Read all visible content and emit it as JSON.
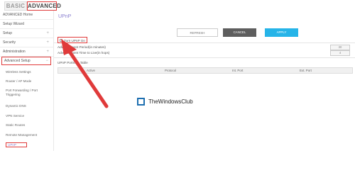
{
  "tabs": {
    "basic": "BASIC",
    "advanced": "ADVANCED"
  },
  "sidebar": {
    "items": [
      {
        "label": "ADVANCED Home"
      },
      {
        "label": "Setup Wizard"
      },
      {
        "label": "Setup",
        "plus": "+"
      },
      {
        "label": "Security",
        "plus": "+"
      },
      {
        "label": "Administration",
        "plus": "+"
      },
      {
        "label": "Advanced Setup",
        "plus": "−"
      }
    ],
    "sub_items": [
      {
        "label": "Wireless Settings"
      },
      {
        "label": "Router / AP Mode"
      },
      {
        "label": "Port Forwarding / Port Triggering"
      },
      {
        "label": "Dynamic DNS"
      },
      {
        "label": "VPN Service"
      },
      {
        "label": "Static Routes"
      },
      {
        "label": "Remote Management"
      },
      {
        "label": "UPnP"
      }
    ]
  },
  "main": {
    "title": "UPnP",
    "buttons": {
      "refresh": "REFRESH",
      "cancel": "CANCEL",
      "apply": "APPLY"
    },
    "toggle_label": "Turn UPnP On",
    "fields": [
      {
        "label": "Advertisement Period(in minutes)",
        "value": "30"
      },
      {
        "label": "Advertisement Time to Live(in hops)",
        "value": "4"
      }
    ],
    "section_label": "UPnP Portmap Table",
    "table_headers": [
      "Active",
      "Protocol",
      "Int. Port",
      "Ext. Port"
    ]
  },
  "watermark": "TheWindowsClub",
  "colors": {
    "accent_red": "#e03a3a",
    "apply_blue": "#26b4e8",
    "cancel_gray": "#5e5e5e",
    "title_purple": "#8a7fd0"
  }
}
